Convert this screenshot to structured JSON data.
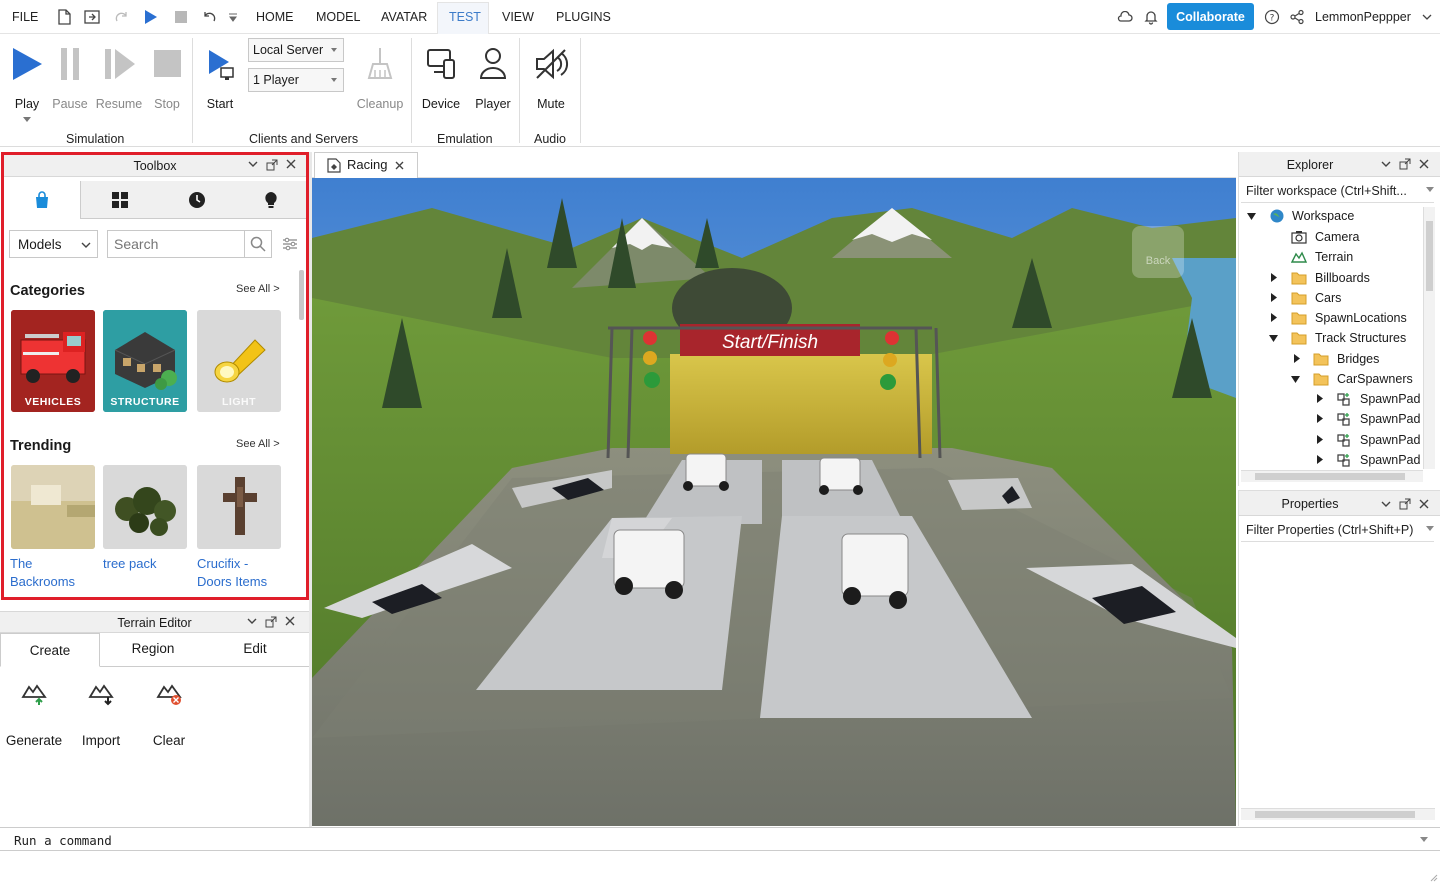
{
  "menubar": {
    "file": "FILE",
    "tabs": [
      "HOME",
      "MODEL",
      "AVATAR",
      "TEST",
      "VIEW",
      "PLUGINS"
    ],
    "active_tab": "TEST",
    "collaborate": "Collaborate",
    "username": "LemmonPeppper"
  },
  "ribbon": {
    "play": "Play",
    "pause": "Pause",
    "resume": "Resume",
    "stop": "Stop",
    "simulation_group": "Simulation",
    "start": "Start",
    "server_select": "Local Server",
    "players_select": "1 Player",
    "cleanup": "Cleanup",
    "clients_group": "Clients and Servers",
    "device": "Device",
    "player": "Player",
    "emulation_group": "Emulation",
    "mute": "Mute",
    "audio_group": "Audio"
  },
  "toolbox": {
    "title": "Toolbox",
    "category_select": "Models",
    "search_placeholder": "Search",
    "categories_heading": "Categories",
    "see_all": "See All >",
    "categories": [
      {
        "label": "VEHICLES"
      },
      {
        "label": "STRUCTURE"
      },
      {
        "label": "LIGHT"
      }
    ],
    "trending_heading": "Trending",
    "trending": [
      {
        "line1": "The",
        "line2": "Backrooms"
      },
      {
        "line1": "tree pack",
        "line2": ""
      },
      {
        "line1": "Crucifix -",
        "line2": "Doors Items"
      }
    ]
  },
  "terrain_editor": {
    "title": "Terrain Editor",
    "tabs": [
      "Create",
      "Region",
      "Edit"
    ],
    "tools": [
      "Generate",
      "Import",
      "Clear"
    ]
  },
  "document": {
    "tab_label": "Racing",
    "banner": "Start/Finish",
    "back_label": "Back"
  },
  "explorer": {
    "title": "Explorer",
    "filter": "Filter workspace (Ctrl+Shift...",
    "tree": [
      {
        "label": "Workspace"
      },
      {
        "label": "Camera"
      },
      {
        "label": "Terrain"
      },
      {
        "label": "Billboards"
      },
      {
        "label": "Cars"
      },
      {
        "label": "SpawnLocations"
      },
      {
        "label": "Track Structures"
      },
      {
        "label": "Bridges"
      },
      {
        "label": "CarSpawners"
      },
      {
        "label": "SpawnPad"
      },
      {
        "label": "SpawnPad"
      },
      {
        "label": "SpawnPad"
      },
      {
        "label": "SpawnPad"
      }
    ]
  },
  "properties": {
    "title": "Properties",
    "filter": "Filter Properties (Ctrl+Shift+P)"
  },
  "command_bar": {
    "placeholder": "Run a command"
  },
  "colors": {
    "accent": "#1a8cda",
    "highlight_border": "#e01e2a",
    "link": "#2b6dcd"
  }
}
